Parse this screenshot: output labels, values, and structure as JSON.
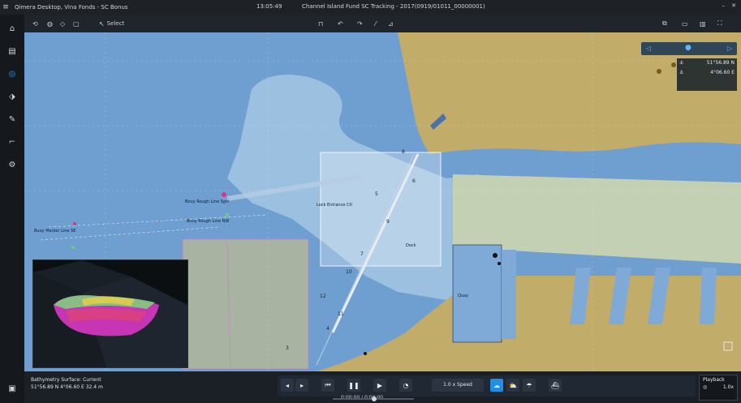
{
  "app": {
    "title": "Qimera Desktop, Vina Fonds - SC Bonus",
    "clock": "13:05:49",
    "file_title": "Channel Island Fund SC Tracking - 2017(0919/01011_00000001)"
  },
  "toolbar": {
    "tool_label": "Select"
  },
  "map_overlay": {
    "labels": [
      "Bouy Rough Line Sgnl",
      "Bouy Rough Line NW",
      "Buoy Marker Line SE",
      "Lock Entrance Ctl",
      "Quay",
      "Dock"
    ],
    "depths": [
      "8",
      "6",
      "5",
      "9",
      "7",
      "10",
      "12",
      "11",
      "4",
      "3"
    ]
  },
  "compass_widget": {
    "lat": "51°56.89 N",
    "lon": "4°06.60 E"
  },
  "status": {
    "line1": "Bathymetry Surface: Current",
    "line2": "51°56.89 N 4°06.60 E  32.4 m"
  },
  "playback": {
    "speed_label": "1.0 x Speed",
    "timescale": "0:00:00 / 0:00:00"
  },
  "right_panel": {
    "title": "Playback",
    "value": "1.0x"
  },
  "colors": {
    "deep_water": "#6f9fd0",
    "shallow_water": "#9cc0df",
    "land": "#c2ac6a",
    "dredged": "#c4d0b4",
    "accent": "#1f8fe6"
  }
}
